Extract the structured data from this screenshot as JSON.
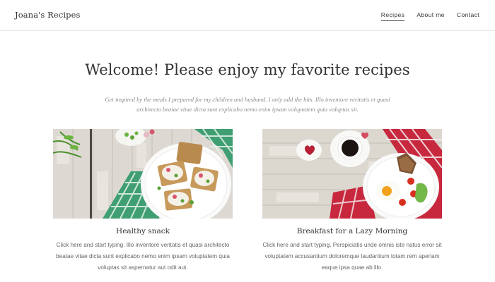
{
  "header": {
    "brand": "Joana's Recipes",
    "nav": [
      {
        "label": "Recipes",
        "active": true
      },
      {
        "label": "About me",
        "active": false
      },
      {
        "label": "Contact",
        "active": false
      }
    ]
  },
  "hero": {
    "title": "Welcome! Please enjoy my favorite recipes",
    "subtitle": "Get inspired by the meals I prepared for my children and husband. I only add the hits. Illo inventore veritatis et quasi architecto beatae vitae dicta sunt explicabo nemo enim ipsam voluptatem quia voluptas sit."
  },
  "cards": [
    {
      "title": "Healthy snack",
      "text": "Click here and start typing. Illo inventore veritatis et quasi architecto beatae vitae dicta sunt explicabo nemo enim ipsam voluptatem quia voluptas sit aspernatur aut odit aut."
    },
    {
      "title": "Breakfast for a Lazy Morning",
      "text": "Click here and start typing. Perspiciatis unde omnis iste natus error sit voluptatem accusantium doloremque laudantium totam rem aperiam eaque ipsa quae ab illo."
    }
  ]
}
